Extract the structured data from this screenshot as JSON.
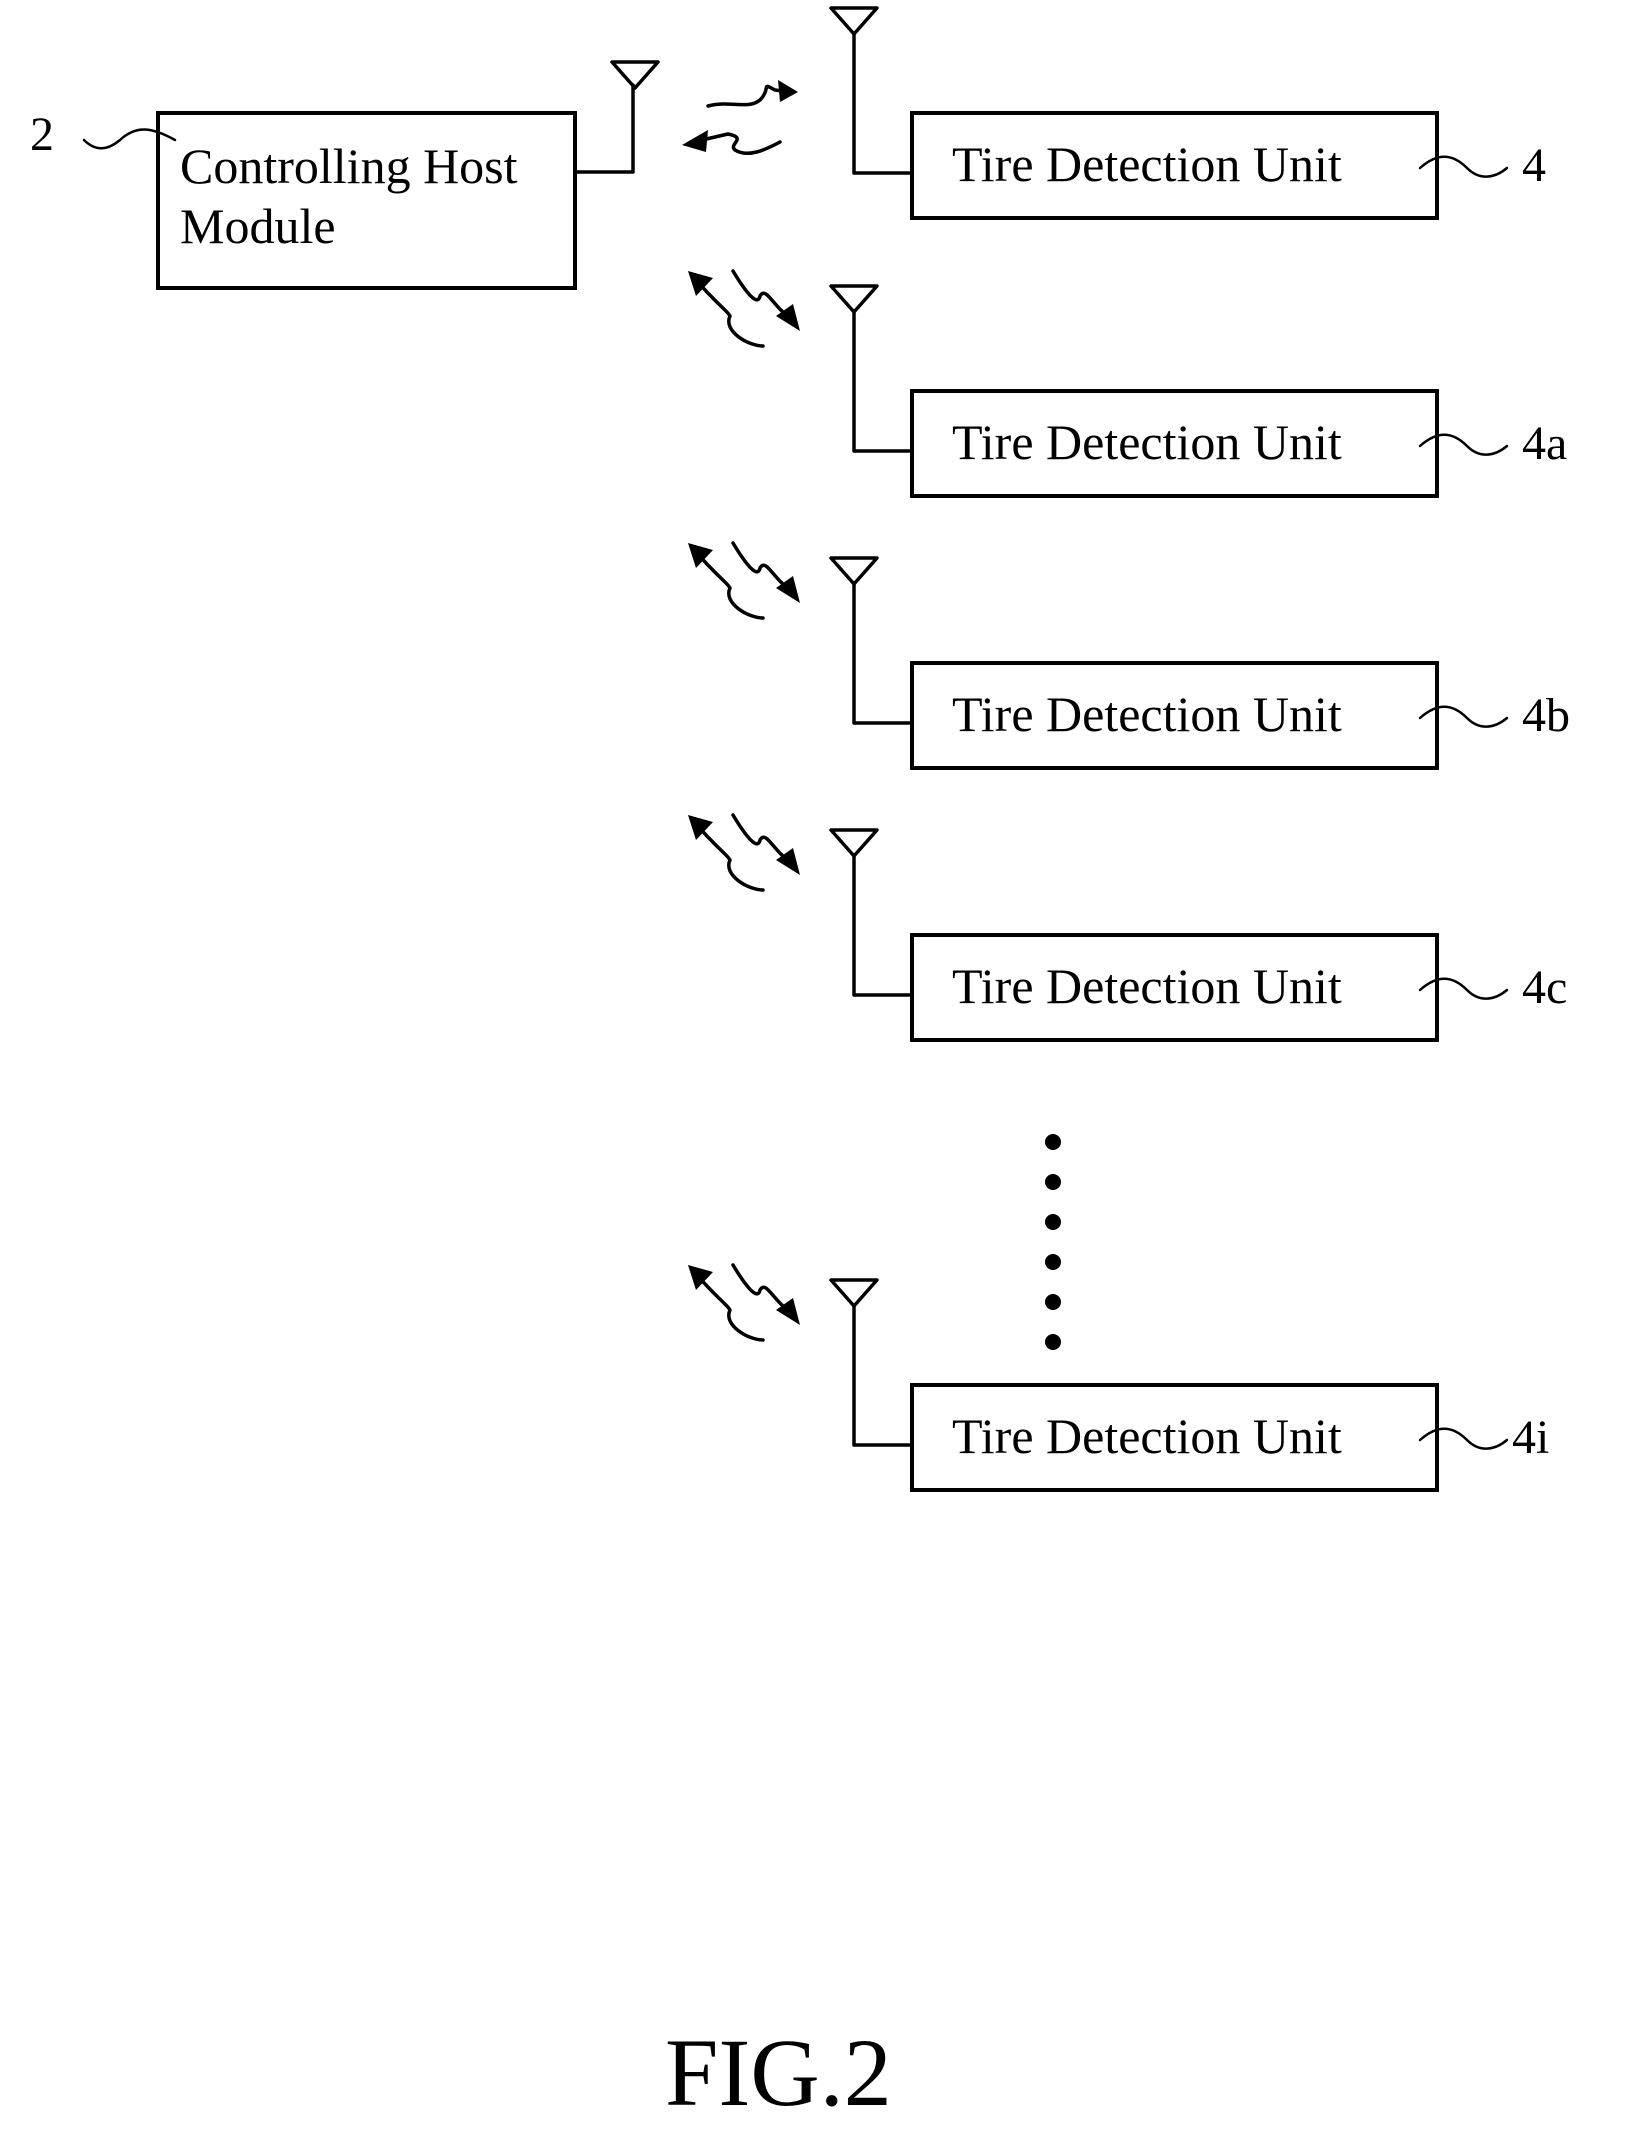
{
  "figure": {
    "caption": "FIG.2",
    "host": {
      "label_line1": "Controlling Host",
      "label_line2": "Module",
      "ref": "2"
    },
    "units": [
      {
        "label": "Tire Detection Unit",
        "ref": "4"
      },
      {
        "label": "Tire Detection Unit",
        "ref": "4a"
      },
      {
        "label": "Tire Detection Unit",
        "ref": "4b"
      },
      {
        "label": "Tire Detection Unit",
        "ref": "4c"
      },
      {
        "label": "Tire Detection Unit",
        "ref": "4i"
      }
    ],
    "ellipsis_dots": 6,
    "link_type": "wireless-bidirectional"
  }
}
